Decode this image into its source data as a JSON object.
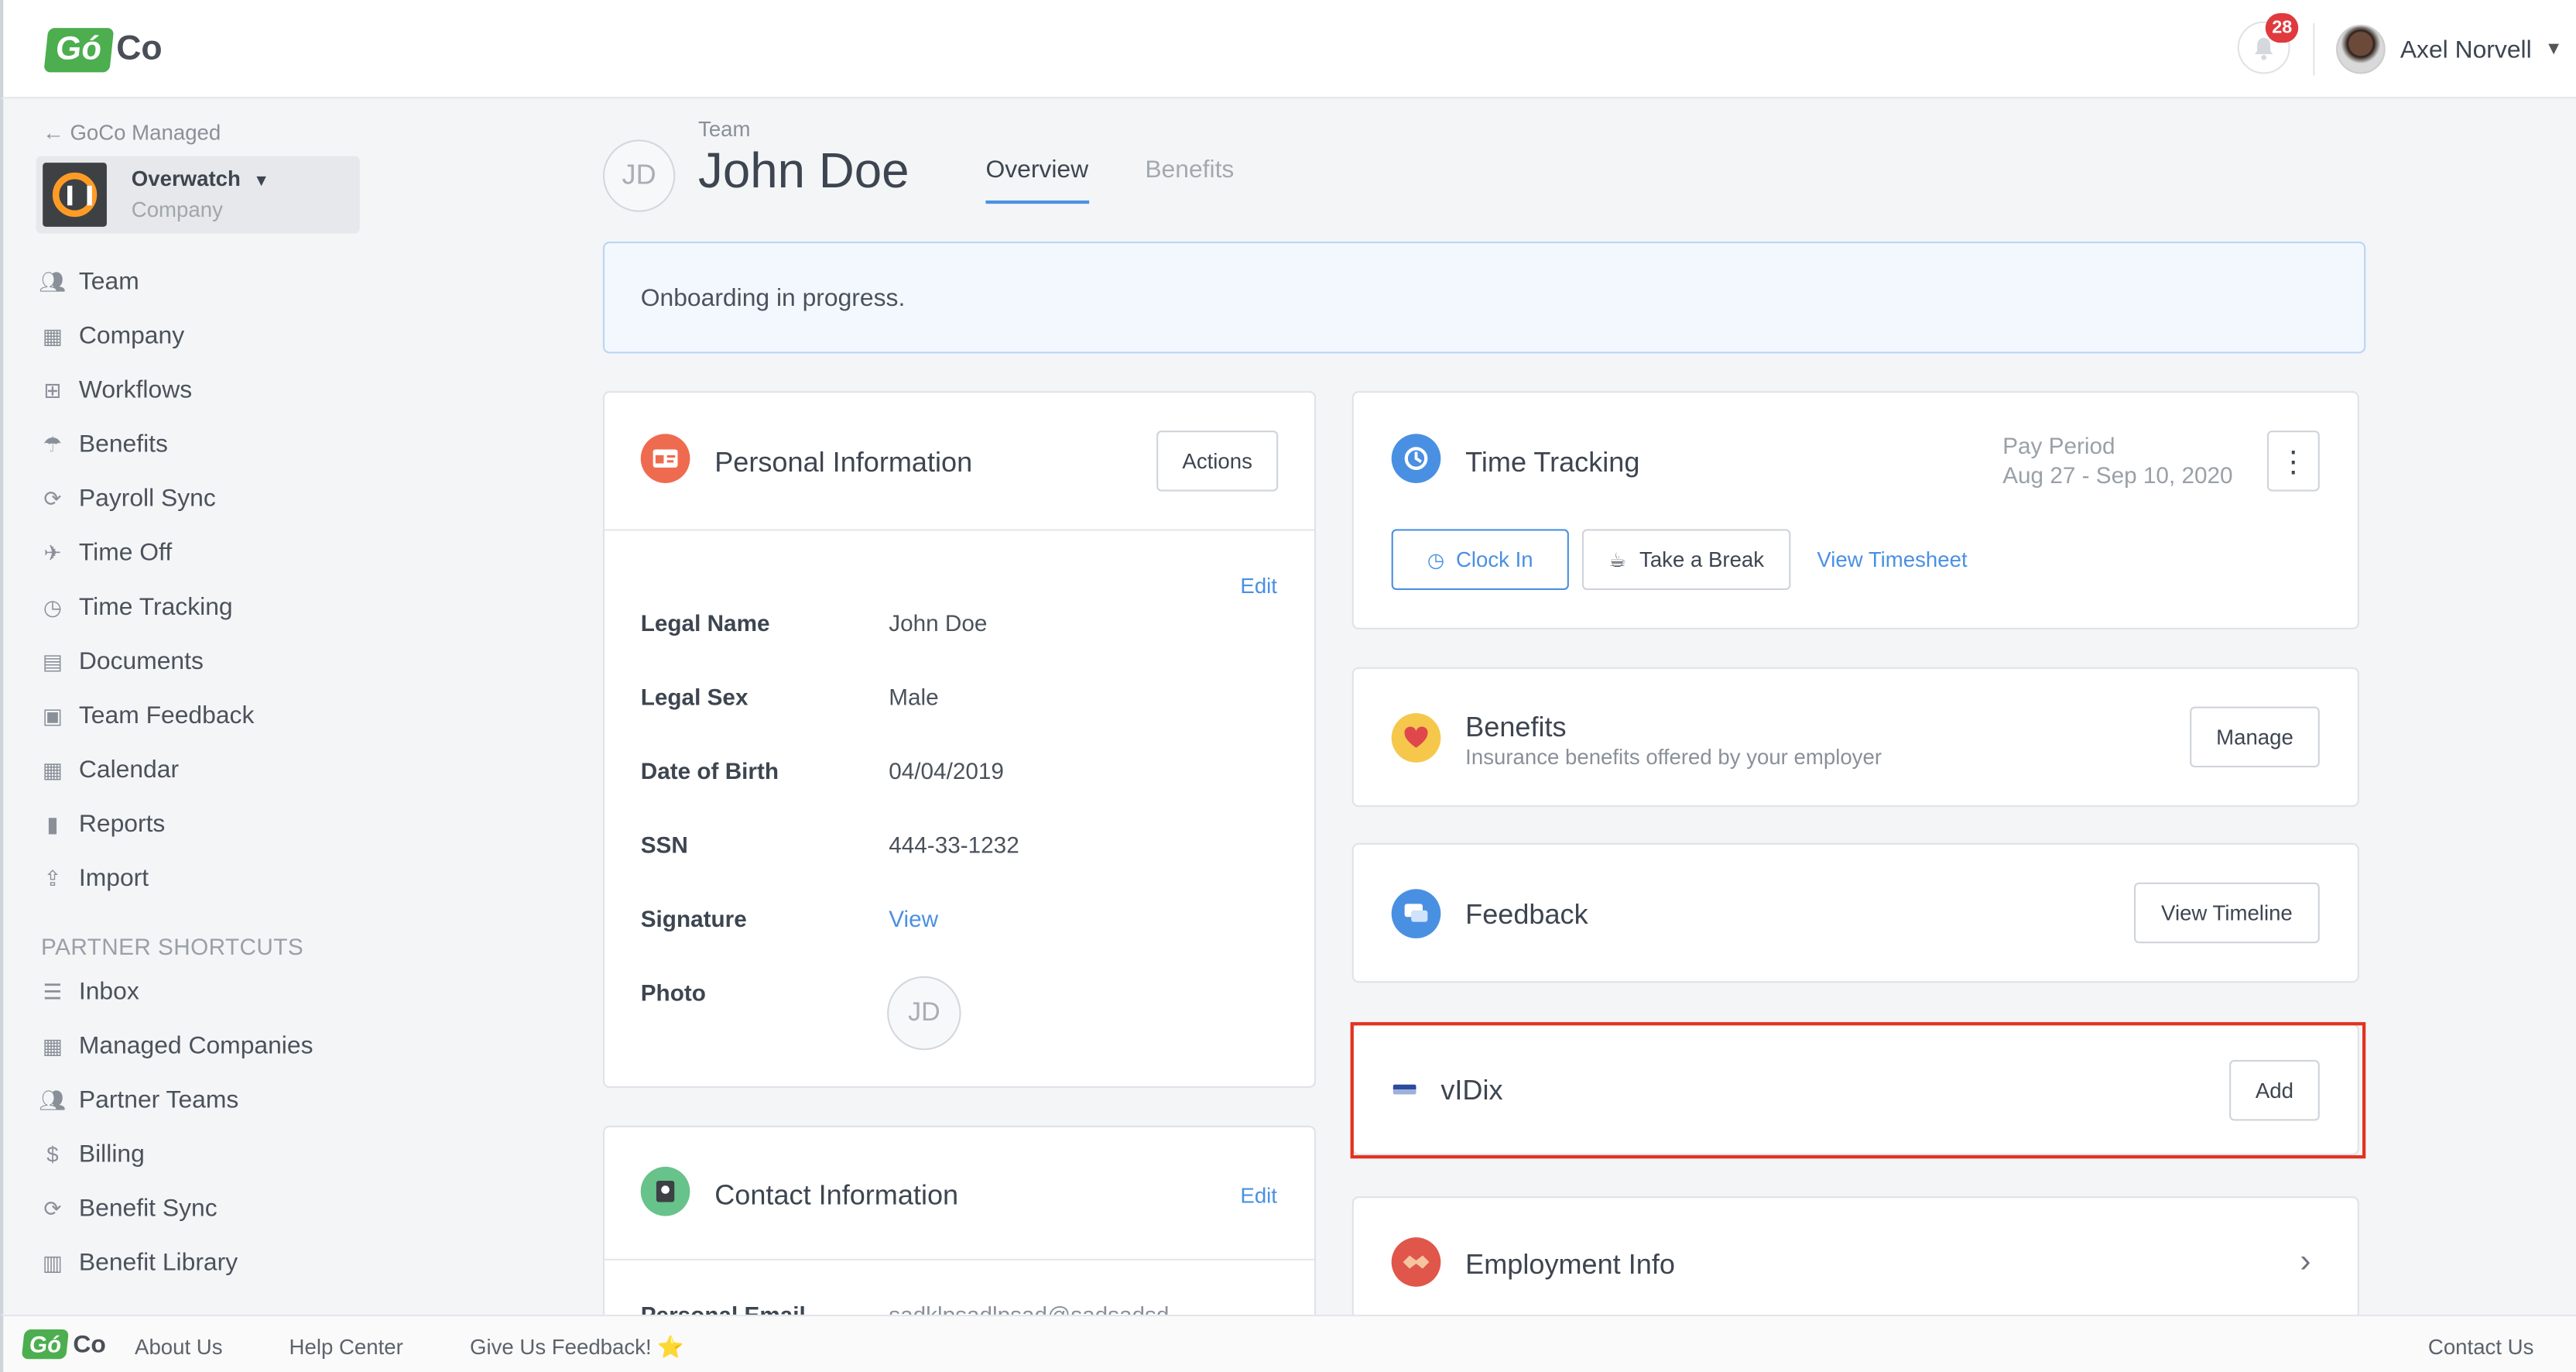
{
  "app": {
    "logo_go": "Gó",
    "logo_co": "Co"
  },
  "topbar": {
    "notifications_count": "28",
    "user_name": "Axel Norvell",
    "user_caret": "⌄"
  },
  "sidebar": {
    "back_label": "← GoCo Managed",
    "company_name": "Overwatch",
    "company_caret": "⌄",
    "company_sub": "Company",
    "nav": [
      {
        "label": "Team",
        "icon": "team-icon"
      },
      {
        "label": "Company",
        "icon": "building-icon"
      },
      {
        "label": "Workflows",
        "icon": "workflow-icon"
      },
      {
        "label": "Benefits",
        "icon": "umbrella-icon"
      },
      {
        "label": "Payroll Sync",
        "icon": "sync-icon"
      },
      {
        "label": "Time Off",
        "icon": "plane-icon"
      },
      {
        "label": "Time Tracking",
        "icon": "clock-icon"
      },
      {
        "label": "Documents",
        "icon": "document-icon"
      },
      {
        "label": "Team Feedback",
        "icon": "chat-icon"
      },
      {
        "label": "Calendar",
        "icon": "calendar-icon"
      },
      {
        "label": "Reports",
        "icon": "chart-icon"
      },
      {
        "label": "Import",
        "icon": "upload-icon"
      }
    ],
    "section_title": "PARTNER SHORTCUTS",
    "partner": [
      {
        "label": "Inbox",
        "icon": "list-icon"
      },
      {
        "label": "Managed Companies",
        "icon": "building-icon"
      },
      {
        "label": "Partner Teams",
        "icon": "team-icon"
      },
      {
        "label": "Billing",
        "icon": "dollar-icon"
      },
      {
        "label": "Benefit Sync",
        "icon": "sync-icon"
      },
      {
        "label": "Benefit Library",
        "icon": "book-icon"
      }
    ]
  },
  "header": {
    "breadcrumb": "Team",
    "initials": "JD",
    "name": "John Doe",
    "tabs": [
      {
        "label": "Overview"
      },
      {
        "label": "Benefits"
      }
    ]
  },
  "banner": {
    "text": "Onboarding in progress."
  },
  "personal": {
    "title": "Personal Information",
    "actions_label": "Actions",
    "edit_label": "Edit",
    "fields": [
      {
        "label": "Legal Name",
        "value": "John Doe"
      },
      {
        "label": "Legal Sex",
        "value": "Male"
      },
      {
        "label": "Date of Birth",
        "value": "04/04/2019"
      },
      {
        "label": "SSN",
        "value": "444-33-1232"
      }
    ],
    "signature_label": "Signature",
    "signature_link": "View",
    "photo_label": "Photo",
    "photo_initials": "JD"
  },
  "contact": {
    "title": "Contact Information",
    "edit_label": "Edit",
    "first_field_label": "Personal Email",
    "first_field_value": "sadklpsadlpsad@sadsadsd"
  },
  "time_tracking": {
    "title": "Time Tracking",
    "pay_period_label": "Pay Period",
    "pay_period_value": "Aug 27 - Sep 10, 2020",
    "clock_in_label": "Clock In",
    "break_label": "Take a Break",
    "timesheet_label": "View Timesheet"
  },
  "benefits_card": {
    "title": "Benefits",
    "subtitle": "Insurance benefits offered by your employer",
    "button_label": "Manage"
  },
  "feedback_card": {
    "title": "Feedback",
    "button_label": "View Timeline"
  },
  "vidix_card": {
    "title": "vIDix",
    "button_label": "Add"
  },
  "employment_card": {
    "title": "Employment Info"
  },
  "footer": {
    "links": [
      {
        "label": "About Us"
      },
      {
        "label": "Help Center"
      },
      {
        "label": "Give Us Feedback! ⭐"
      }
    ],
    "contact_label": "Contact Us"
  },
  "colors": {
    "accent": "#4a90e2",
    "brand_green": "#4cae4f",
    "highlight": "#e2321f",
    "badge": "#e03a3e"
  }
}
